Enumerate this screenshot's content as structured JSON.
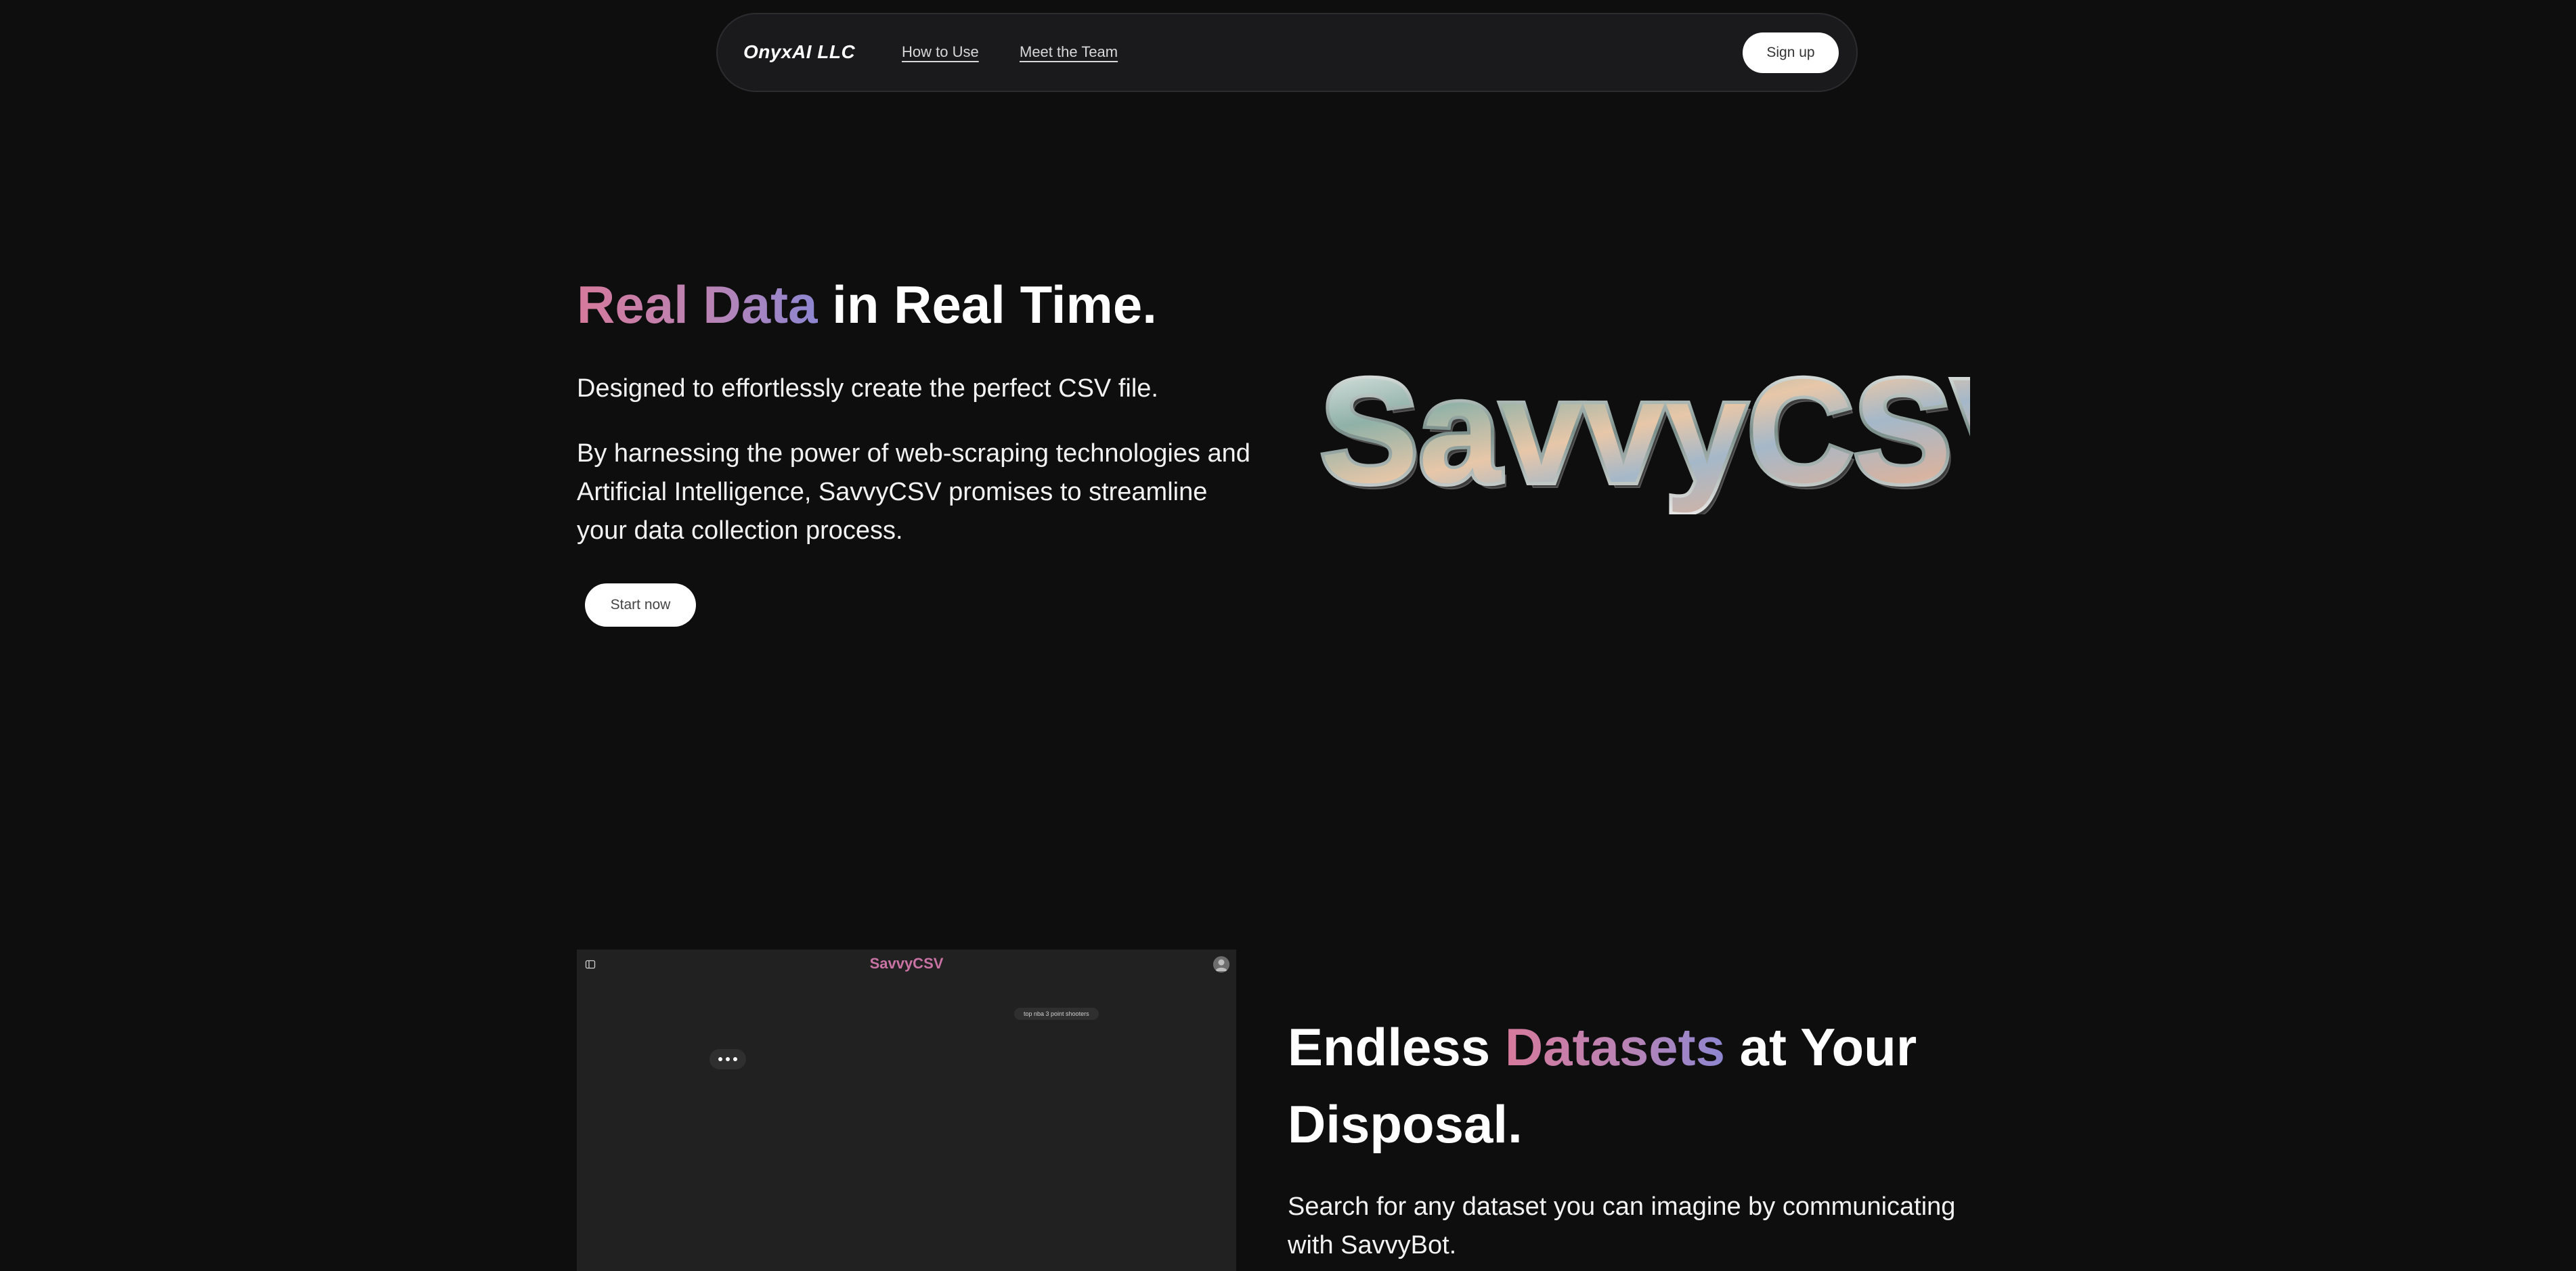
{
  "nav": {
    "brand": "OnyxAI LLC",
    "links": [
      "How to Use",
      "Meet the Team"
    ],
    "signup_label": "Sign up"
  },
  "hero": {
    "title_highlight": "Real Data",
    "title_rest": " in Real Time.",
    "subtitle": "Designed to effortlessly create the perfect CSV file.",
    "paragraph": "By harnessing the power of web-scraping technologies and Artificial Intelligence, SavvyCSV promises to streamline your data collection process.",
    "cta_label": "Start now",
    "logo_text": "SavvyCSV"
  },
  "app_preview": {
    "title": "SavvyCSV",
    "query": "top nba 3 point shooters",
    "icons": [
      "sidebar-toggle-icon",
      "avatar-icon",
      "typing-indicator"
    ]
  },
  "section2": {
    "title_start": "Endless ",
    "title_highlight": "Datasets",
    "title_end": " at Your Disposal.",
    "paragraph": "Search for any dataset you can imagine by communicating with SavvyBot."
  },
  "colors": {
    "background": "#0e0e0f",
    "nav_background": "#1a1a1c",
    "gradient_start": "#d67a9c",
    "gradient_end": "#8d86d1",
    "app_title": "#c873a3"
  }
}
